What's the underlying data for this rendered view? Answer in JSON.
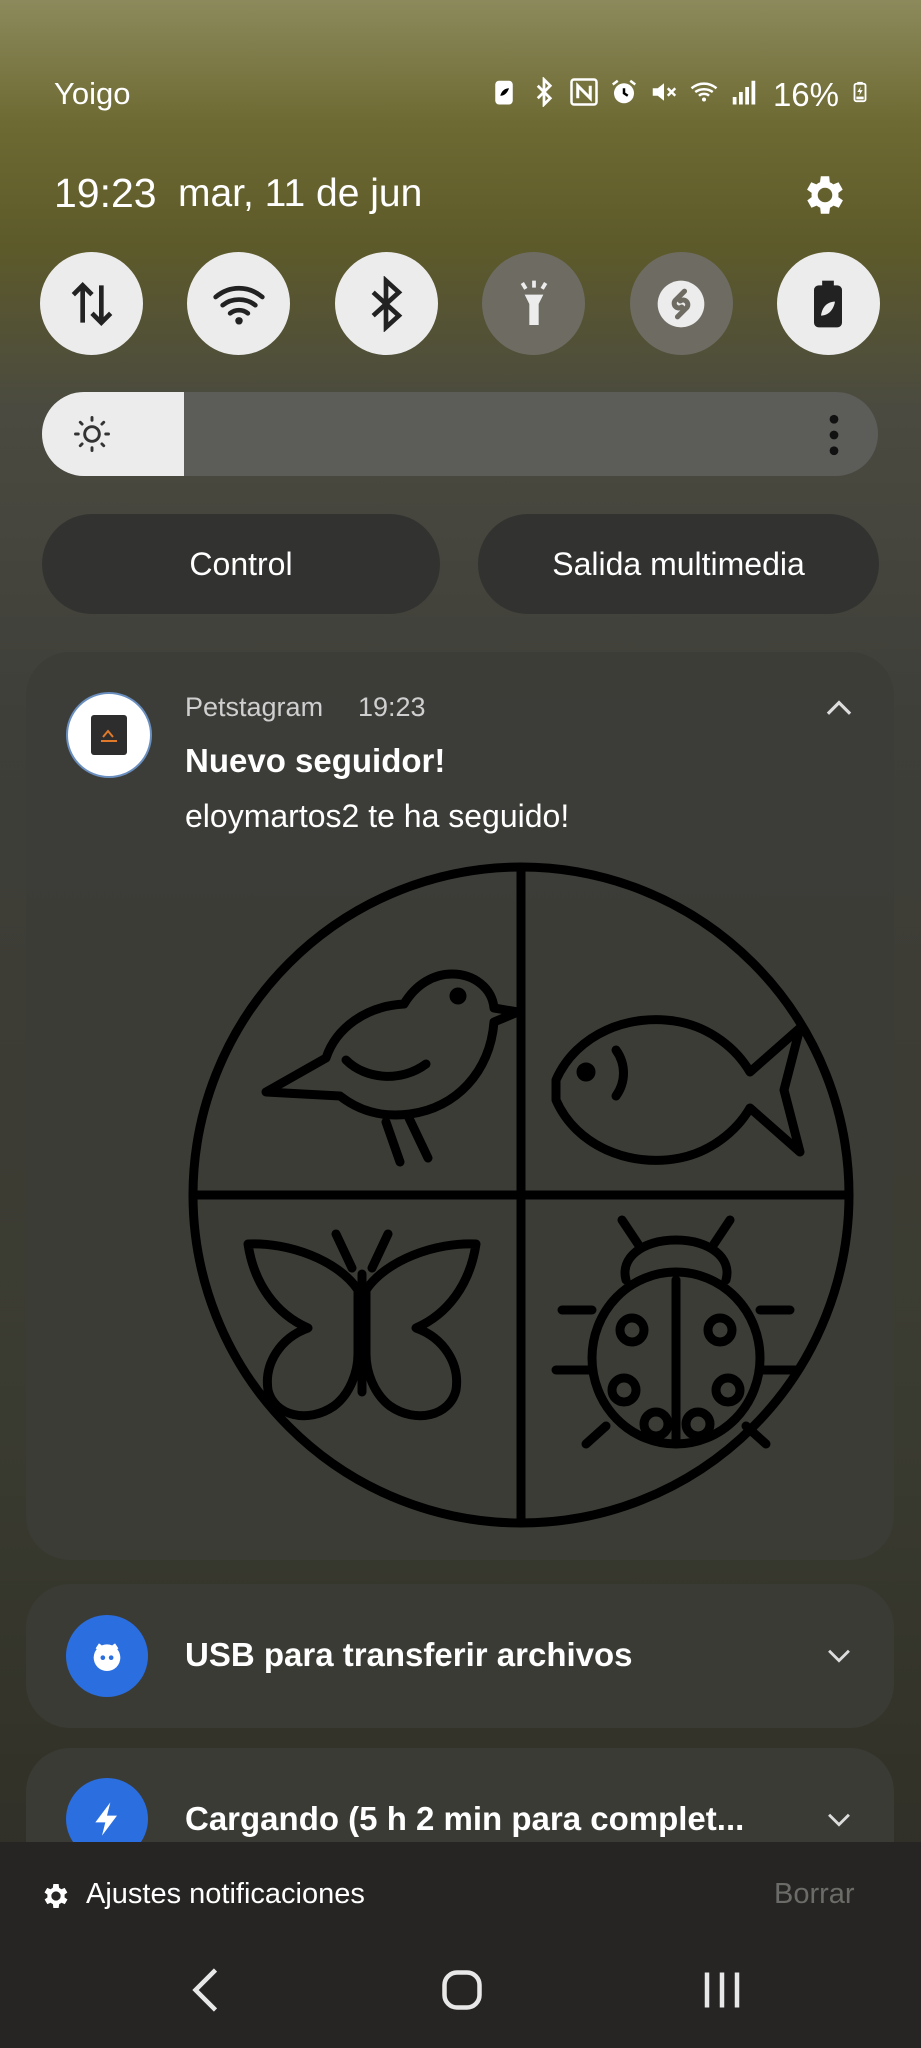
{
  "status_bar": {
    "carrier": "Yoigo",
    "battery": "16%",
    "icons": [
      "battery-saver-icon",
      "bluetooth-icon",
      "nfc-icon",
      "alarm-icon",
      "mute-icon",
      "wifi-icon",
      "signal-icon",
      "battery-charging-icon"
    ]
  },
  "header": {
    "time": "19:23",
    "date": "mar, 11 de jun",
    "settings_icon": "gear-icon"
  },
  "quick_settings": {
    "tiles": [
      {
        "name": "mobile-data",
        "icon": "data-arrows-icon",
        "state": "on"
      },
      {
        "name": "wifi",
        "icon": "wifi-icon",
        "state": "on"
      },
      {
        "name": "bluetooth",
        "icon": "bluetooth-icon",
        "state": "on"
      },
      {
        "name": "flashlight",
        "icon": "flashlight-icon",
        "state": "off"
      },
      {
        "name": "shazam",
        "icon": "shazam-icon",
        "state": "off"
      },
      {
        "name": "power-saving",
        "icon": "battery-leaf-icon",
        "state": "on"
      }
    ],
    "brightness_level": 0.17
  },
  "buttons": {
    "control": "Control",
    "media_output": "Salida multimedia"
  },
  "notifications": {
    "petstagram": {
      "app": "Petstagram",
      "time": "19:23",
      "title": "Nuevo seguidor!",
      "body": "eloymartos2 te ha seguido!",
      "image": "pet-categories-circle-icon"
    },
    "usb": {
      "title": "USB para transferir archivos",
      "icon": "usb-icon"
    },
    "charging": {
      "title": "Cargando (5 h 2 min para complet...",
      "icon": "lightning-icon"
    }
  },
  "footer": {
    "settings": "Ajustes notificaciones",
    "clear": "Borrar"
  },
  "colors": {
    "tile_on": "#ececec",
    "tile_off": "#6e6c62",
    "accent_blue": "#2a6ee0"
  }
}
